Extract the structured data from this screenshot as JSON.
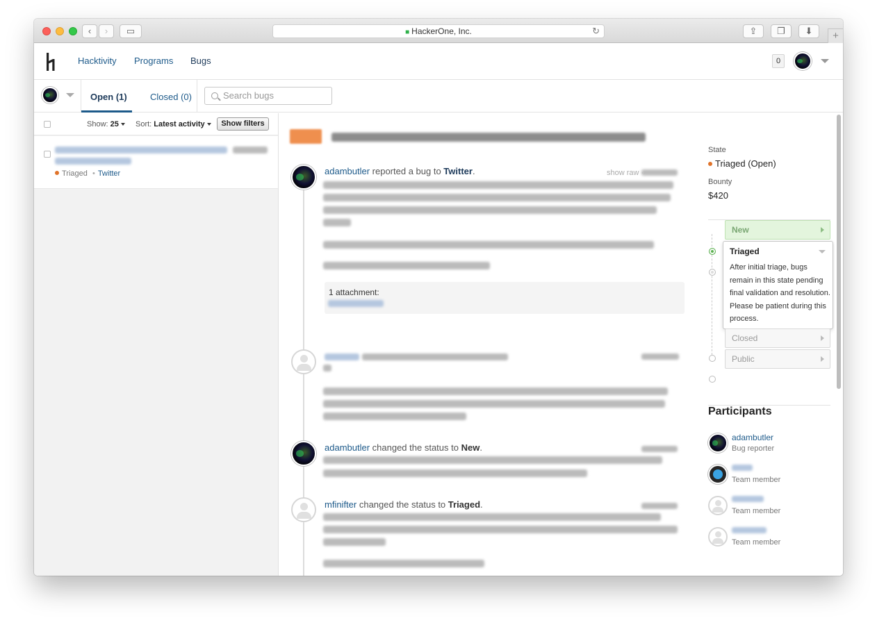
{
  "browser": {
    "address": "HackerOne, Inc."
  },
  "header": {
    "nav": [
      "Hacktivity",
      "Programs",
      "Bugs"
    ],
    "notification_count": "0"
  },
  "subheader": {
    "tab_open": "Open (1)",
    "tab_closed": "Closed (0)",
    "search_placeholder": "Search bugs"
  },
  "list": {
    "show_label": "Show:",
    "show_value": "25",
    "sort_label": "Sort:",
    "sort_value": "Latest activity",
    "show_filters": "Show filters",
    "item": {
      "status": "Triaged",
      "program": "Twitter",
      "separator": "•"
    }
  },
  "report": {
    "events": [
      {
        "user": "adambutler",
        "text": " reported a bug to ",
        "target": "Twitter",
        "suffix": "."
      },
      {
        "user": "adambutler",
        "text": " changed the status to ",
        "target": "New",
        "suffix": "."
      },
      {
        "user": "mfinifter",
        "text": " changed the status to ",
        "target": "Triaged",
        "suffix": "."
      }
    ],
    "show_raw": "show raw ·",
    "attachment_label": "1 attachment:"
  },
  "sidebar": {
    "state_label": "State",
    "state_value": "Triaged (Open)",
    "bounty_label": "Bounty",
    "bounty_value": "$420",
    "statuses": {
      "new": "New",
      "triaged": "Triaged",
      "triaged_desc": "After initial triage, bugs remain in this state pending final validation and resolution. Please be patient during this process.",
      "closed": "Closed",
      "public": "Public"
    },
    "participants_title": "Participants",
    "participants": [
      {
        "name": "adambutler",
        "role": "Bug reporter"
      },
      {
        "name": "",
        "role": "Team member"
      },
      {
        "name": "",
        "role": "Team member"
      },
      {
        "name": "",
        "role": "Team member"
      }
    ]
  },
  "colors": {
    "link": "#1d5a8a",
    "triaged_dot": "#e0732a",
    "new_status_bg": "#e3f5dd"
  }
}
